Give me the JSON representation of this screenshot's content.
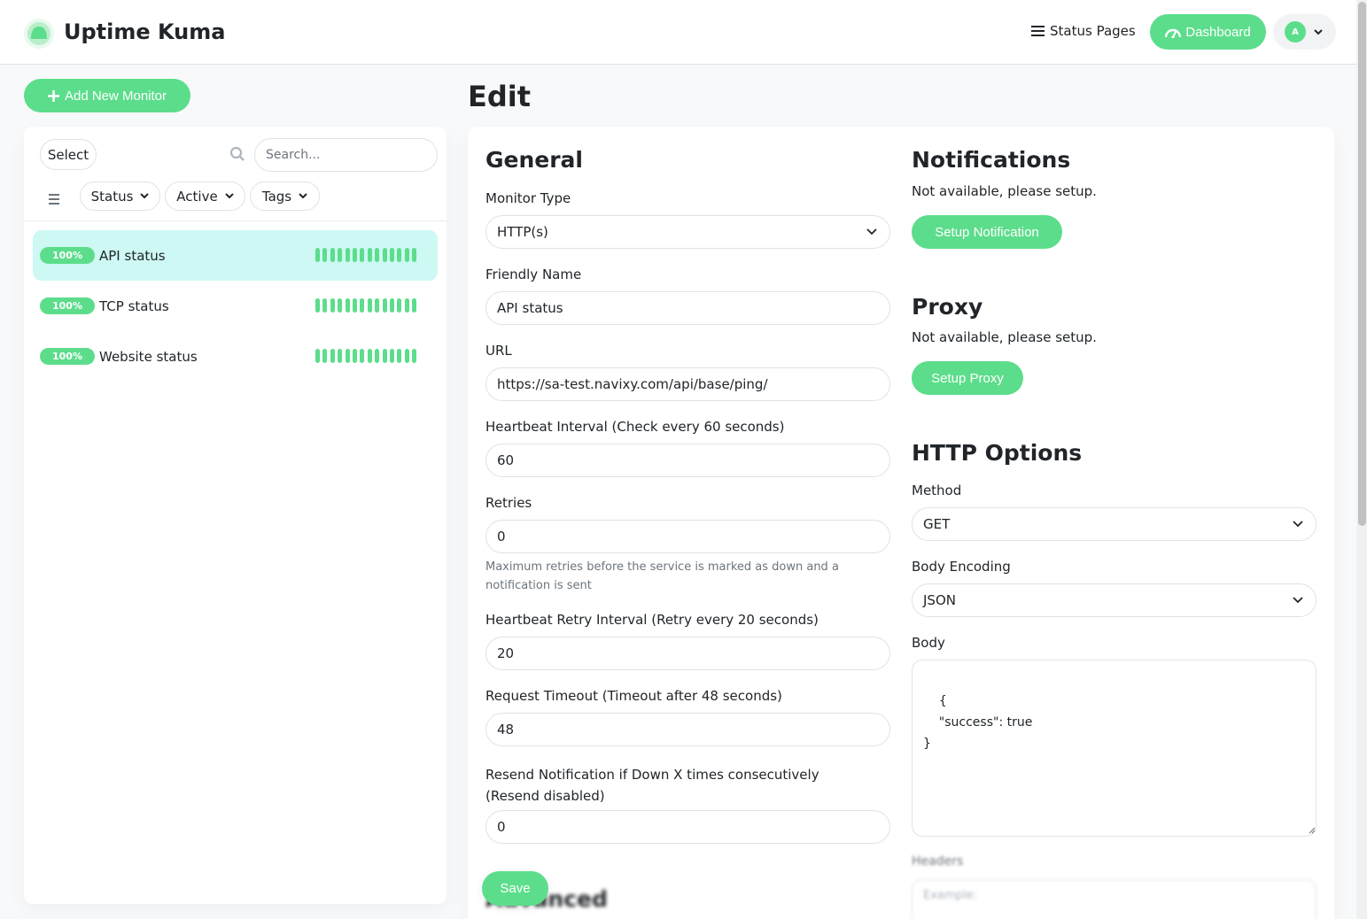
{
  "app": {
    "title": "Uptime Kuma",
    "accent_color": "#5cdd8b",
    "logo_icon": "uptime-kuma-logo"
  },
  "header": {
    "status_pages_label": "Status Pages",
    "dashboard_label": "Dashboard",
    "user_initial": "A"
  },
  "sidebar": {
    "add_monitor_label": "Add New Monitor",
    "select_label": "Select",
    "search_placeholder": "Search...",
    "filters": {
      "status": "Status",
      "active": "Active",
      "tags": "Tags"
    },
    "monitors": [
      {
        "uptime": "100%",
        "name": "API status",
        "selected": true
      },
      {
        "uptime": "100%",
        "name": "TCP status",
        "selected": false
      },
      {
        "uptime": "100%",
        "name": "Website status",
        "selected": false
      }
    ]
  },
  "page": {
    "title": "Edit"
  },
  "general": {
    "title": "General",
    "monitor_type_label": "Monitor Type",
    "monitor_type_value": "HTTP(s)",
    "friendly_name_label": "Friendly Name",
    "friendly_name_value": "API status",
    "url_label": "URL",
    "url_value": "https://sa-test.navixy.com/api/base/ping/",
    "interval_label": "Heartbeat Interval (Check every 60 seconds)",
    "interval_value": "60",
    "retries_label": "Retries",
    "retries_value": "0",
    "retries_hint": "Maximum retries before the service is marked as down and a notification is sent",
    "retry_interval_label": "Heartbeat Retry Interval (Retry every 20 seconds)",
    "retry_interval_value": "20",
    "timeout_label": "Request Timeout (Timeout after 48 seconds)",
    "timeout_value": "48",
    "resend_label": "Resend Notification if Down X times consecutively (Resend disabled)",
    "resend_value": "0",
    "advanced_title": "Advanced",
    "save_label": "Save"
  },
  "notifications": {
    "title": "Notifications",
    "text": "Not available, please setup.",
    "button_label": "Setup Notification"
  },
  "proxy": {
    "title": "Proxy",
    "text": "Not available, please setup.",
    "button_label": "Setup Proxy"
  },
  "http_options": {
    "title": "HTTP Options",
    "method_label": "Method",
    "method_value": "GET",
    "encoding_label": "Body Encoding",
    "encoding_value": "JSON",
    "body_label": "Body",
    "body_value": "{\n    \"success\": true\n}",
    "headers_label": "Headers",
    "headers_placeholder": "Example:"
  }
}
